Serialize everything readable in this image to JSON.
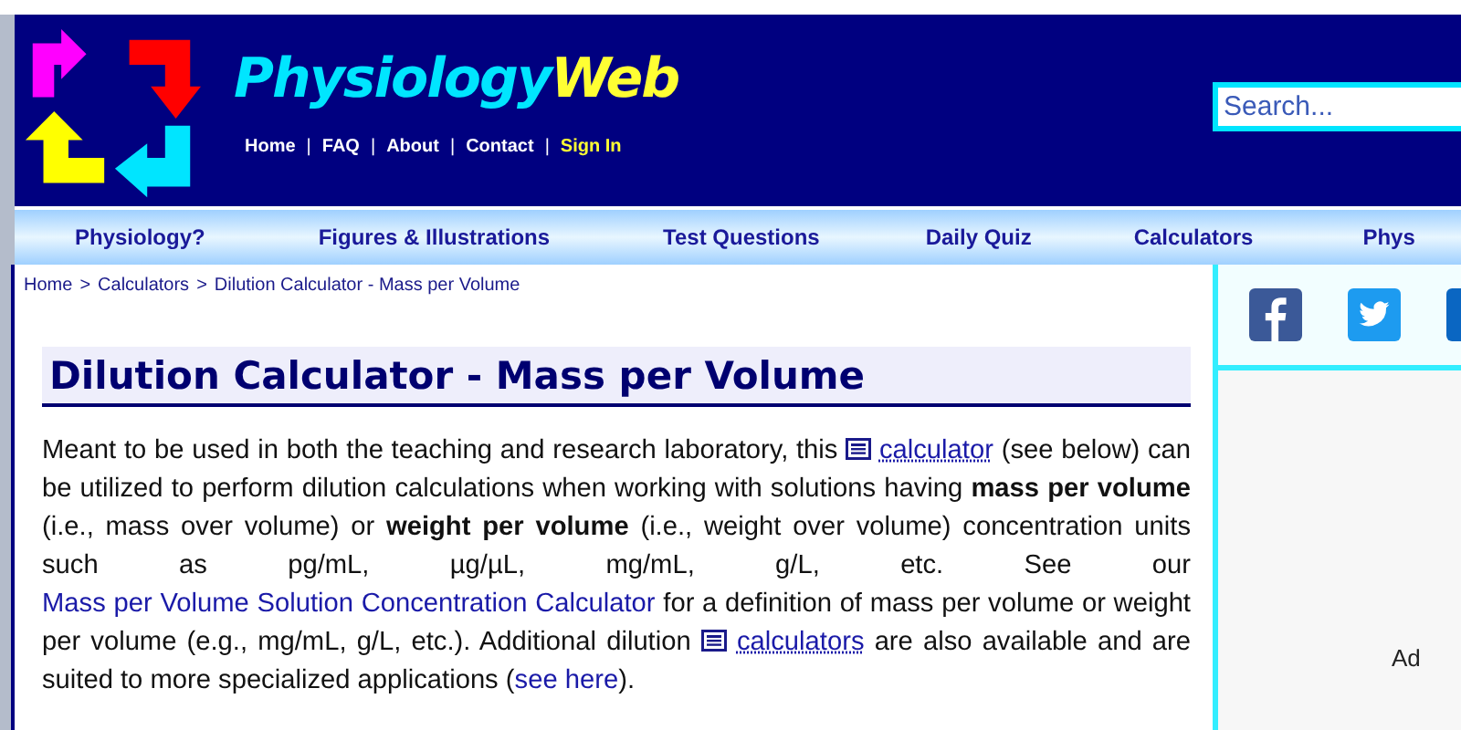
{
  "site": {
    "name_part1": "Physiology",
    "name_part2": "Web"
  },
  "top_links": [
    {
      "label": "Home",
      "kind": "plain"
    },
    {
      "label": "FAQ",
      "kind": "plain"
    },
    {
      "label": "About",
      "kind": "plain"
    },
    {
      "label": "Contact",
      "kind": "plain"
    },
    {
      "label": "Sign In",
      "kind": "highlight"
    }
  ],
  "top_link_separator": "|",
  "search": {
    "placeholder": "Search..."
  },
  "nav": [
    "Physiology?",
    "Figures & Illustrations",
    "Test Questions",
    "Daily Quiz",
    "Calculators",
    "Phys"
  ],
  "breadcrumb": {
    "separator": ">",
    "items": [
      "Home",
      "Calculators",
      "Dilution Calculator - Mass per Volume"
    ]
  },
  "heading": "Dilution Calculator - Mass per Volume",
  "paragraph": [
    {
      "kind": "text",
      "text": "Meant to be used in both the teaching and research laboratory, this "
    },
    {
      "kind": "icon-link",
      "text": "calculator"
    },
    {
      "kind": "text",
      "text": " (see below) can be utilized to perform dilution calculations when working with solutions having **mass per volume** (i.e., mass over volume) or **weight per volume** (i.e., weight over volume) concentration units such as pg/mL, µg/µL, mg/mL, g/L, etc. See our "
    },
    {
      "kind": "link",
      "text": "Mass per Volume Solution Concentration Calculator"
    },
    {
      "kind": "text",
      "text": " for a definition of mass per volume or weight per volume (e.g., mg/mL, g/L, etc.). Additional dilution "
    },
    {
      "kind": "icon-link",
      "text": "calculators"
    },
    {
      "kind": "text",
      "text": " are also available and are suited to more specialized applications ("
    },
    {
      "kind": "link",
      "text": "see here"
    },
    {
      "kind": "text",
      "text": ")."
    }
  ],
  "sidebar": {
    "social": [
      {
        "kind": "facebook"
      },
      {
        "kind": "twitter"
      },
      {
        "kind": "other"
      }
    ],
    "ad_label": "Ad"
  }
}
